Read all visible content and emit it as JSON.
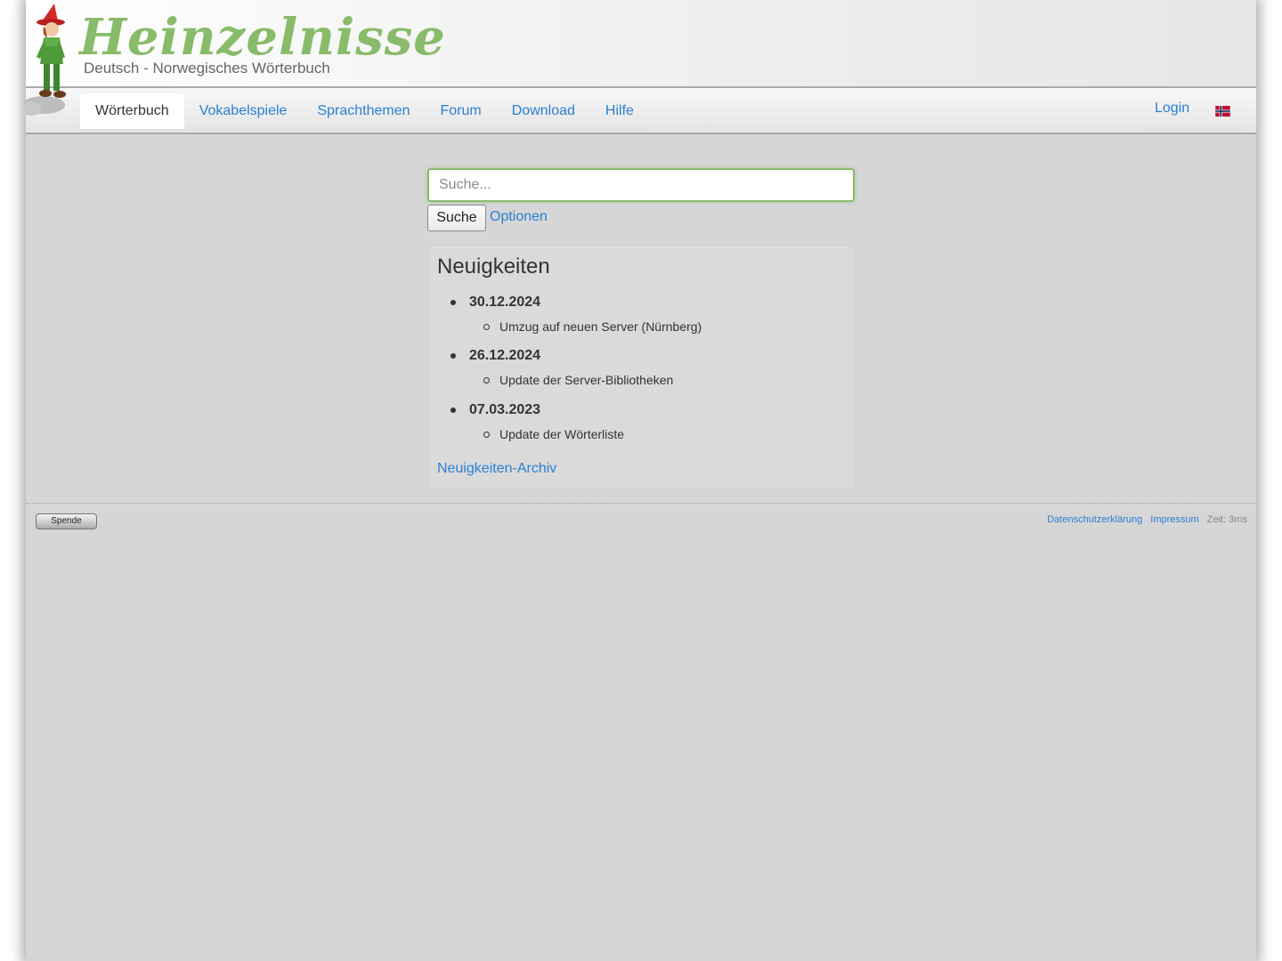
{
  "header": {
    "site_title": "Heinzelnisse",
    "subtitle": "Deutsch - Norwegisches Wörterbuch"
  },
  "nav": {
    "tabs": [
      {
        "label": "Wörterbuch",
        "active": true
      },
      {
        "label": "Vokabelspiele",
        "active": false
      },
      {
        "label": "Sprachthemen",
        "active": false
      },
      {
        "label": "Forum",
        "active": false
      },
      {
        "label": "Download",
        "active": false
      },
      {
        "label": "Hilfe",
        "active": false
      }
    ],
    "login_label": "Login",
    "language_flag_icon": "norway-flag-icon"
  },
  "search": {
    "placeholder": "Suche...",
    "value": "",
    "button_label": "Suche",
    "options_label": "Optionen"
  },
  "news": {
    "title": "Neuigkeiten",
    "entries": [
      {
        "date": "30.12.2024",
        "items": [
          "Umzug auf neuen Server (Nürnberg)"
        ]
      },
      {
        "date": "26.12.2024",
        "items": [
          "Update der Server-Bibliotheken"
        ]
      },
      {
        "date": "07.03.2023",
        "items": [
          "Update der Wörterliste"
        ]
      }
    ],
    "archive_label": "Neuigkeiten-Archiv"
  },
  "footer": {
    "donate_label": "Spende",
    "privacy_label": "Datenschutzerklärung",
    "imprint_label": "Impressum",
    "time_text": "Zeit: 3ms"
  },
  "colors": {
    "brand_green": "#88bb6a",
    "link_blue": "#2a7fd4",
    "background": "#d6d6d6"
  }
}
